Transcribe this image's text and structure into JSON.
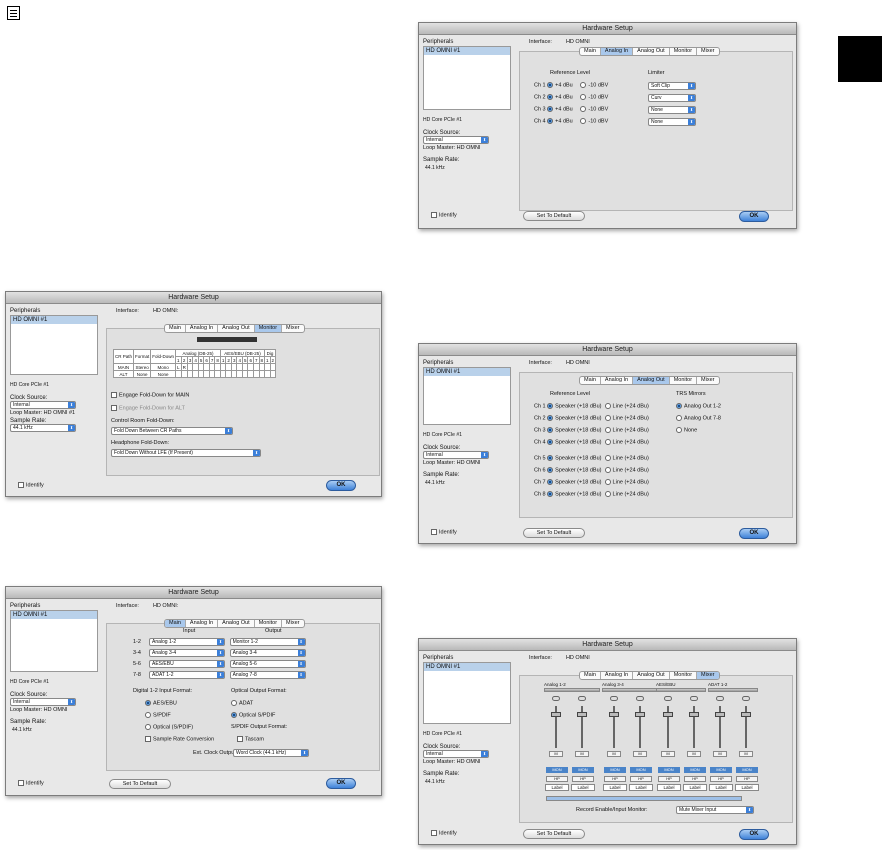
{
  "window_title": "Hardware Setup",
  "peripherals_label": "Peripherals",
  "peripheral": "HD OMNI #1",
  "card": "HD Core PCIe #1",
  "clock_source_label": "Clock Source:",
  "clock_source_value": "Internal",
  "loop_master": "Loop Master: HD OMNI",
  "loop_master_1": "Loop Master: HD OMNI #1",
  "sample_rate_label": "Sample Rate:",
  "sample_rate_value": "44.1 kHz",
  "interface_label": "Interface:",
  "interface_value": "HD OMNI",
  "interface_value_colon": "HD OMNI:",
  "tabs": [
    "Main",
    "Analog In",
    "Analog Out",
    "Monitor",
    "Mixer"
  ],
  "identify": "Identify",
  "set_default": "Set To Default",
  "ok": "OK",
  "analog_in": {
    "ref_label": "Reference Level",
    "limiter_label": "Limiter",
    "rows": [
      {
        "ch": "Ch 1",
        "a": "+4 dBu",
        "b": "-10 dBV",
        "lim": "Soft Clip"
      },
      {
        "ch": "Ch 2",
        "a": "+4 dBu",
        "b": "-10 dBV",
        "lim": "Curv"
      },
      {
        "ch": "Ch 3",
        "a": "+4 dBu",
        "b": "-10 dBV",
        "lim": "None"
      },
      {
        "ch": "Ch 4",
        "a": "+4 dBu",
        "b": "-10 dBV",
        "lim": "None"
      }
    ]
  },
  "monitor": {
    "headers": [
      "CR Path",
      "Format",
      "Fold-Down",
      "Analog (DB-25)",
      "AES/EBU (DB-25)",
      "Dig"
    ],
    "nums": [
      "1",
      "2",
      "3",
      "4",
      "5",
      "6",
      "7",
      "8",
      "1",
      "2",
      "3",
      "4",
      "5",
      "6",
      "7",
      "8",
      "1",
      "2"
    ],
    "rows": [
      {
        "path": "MAIN",
        "format": "Stereo",
        "fold": "Mono",
        "l": "L",
        "r": "R"
      },
      {
        "path": "ALT",
        "format": "None",
        "fold": "None",
        "l": "",
        "r": ""
      }
    ],
    "engage_main": "Engage Fold-Down for MAIN",
    "engage_alt": "Engage Fold-Down for ALT",
    "cr_fold_label": "Control Room Fold-Down:",
    "cr_fold_value": "Fold Down Between CR Paths",
    "hp_fold_label": "Headphone Fold-Down:",
    "hp_fold_value": "Fold Down Without LFE (If Present)"
  },
  "analog_out": {
    "ref_label": "Reference Level",
    "trs_label": "TRS Mirrors",
    "channels": [
      "Ch 1",
      "Ch 2",
      "Ch 3",
      "Ch 4",
      "Ch 5",
      "Ch 6",
      "Ch 7",
      "Ch 8"
    ],
    "speaker": "Speaker (+18 dBu)",
    "line": "Line (+24 dBu)",
    "trs": [
      "Analog Out 1-2",
      "Analog Out 7-8",
      "None"
    ]
  },
  "main": {
    "input_label": "Input",
    "output_label": "Output",
    "rows": [
      {
        "ch": "1-2",
        "in": "Analog 1-2",
        "out": "Monitor 1-2"
      },
      {
        "ch": "3-4",
        "in": "Analog 3-4",
        "out": "Analog 3-4"
      },
      {
        "ch": "5-6",
        "in": "AES/EBU",
        "out": "Analog 5-6"
      },
      {
        "ch": "7-8",
        "in": "ADAT 1-2",
        "out": "Analog 7-8"
      }
    ],
    "digital_label": "Digital 1-2 Input Format:",
    "digital_opts": [
      "AES/EBU",
      "S/PDIF",
      "Optical (S/PDIF)"
    ],
    "src": "Sample Rate Conversion",
    "optical_label": "Optical Output Format:",
    "optical_opts": [
      "ADAT",
      "Optical S/PDIF"
    ],
    "spdif_label": "S/PDIF Output Format:",
    "tascam": "Tascam",
    "ext_label": "Ext. Clock Output:",
    "ext_value": "Word Clock (44.1 kHz)"
  },
  "mixer": {
    "groups": [
      "Analog 1-2",
      "Analog 3-4",
      "AES/EBU",
      "ADAT 1-2"
    ],
    "m": "M",
    "mon": "MON",
    "hp": "HP",
    "label": "Label",
    "rec_label": "Record Enable/Input Monitor:",
    "rec_value": "Mute Mixer Input"
  }
}
